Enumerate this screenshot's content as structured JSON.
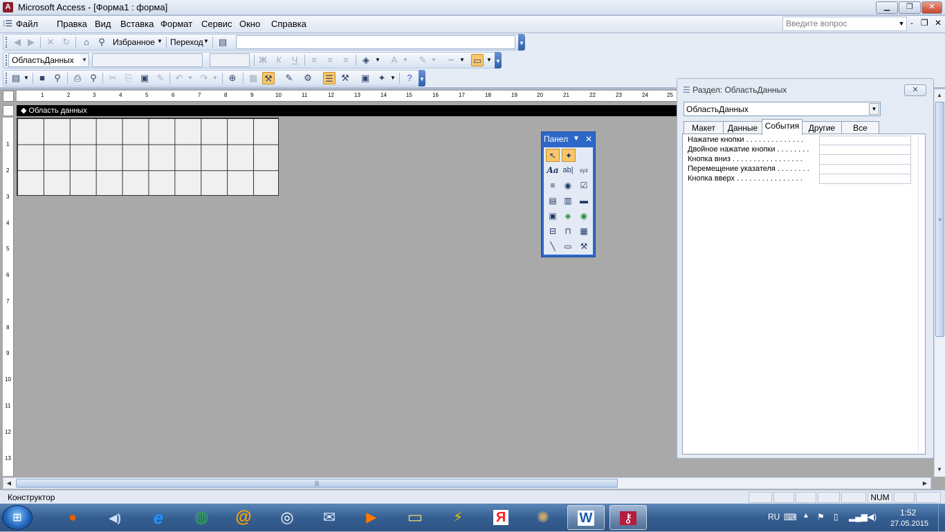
{
  "titlebar": {
    "icon_letter": "A",
    "title": "Microsoft Access - [Форма1 : форма]",
    "minimize": "▁",
    "restore": "❐",
    "close": "✕"
  },
  "menubar": {
    "items": [
      "Файл",
      "Правка",
      "Вид",
      "Вставка",
      "Формат",
      "Сервис",
      "Окно",
      "Справка"
    ],
    "help_placeholder": "Введите вопрос",
    "mdi_buttons": [
      "▾",
      "-",
      "❐",
      "✕"
    ]
  },
  "toolbar_web": {
    "favorites": "Избранное",
    "go": "Переход",
    "address_value": ""
  },
  "toolbar_format": {
    "object_selector": "ОбластьДанных",
    "font_value": "",
    "size_value": "",
    "bold": "Ж",
    "italic": "К",
    "underline": "Ч"
  },
  "ruler": {
    "horizontal_numbers": [
      "1",
      "2",
      "3",
      "4",
      "5",
      "6",
      "7",
      "8",
      "9",
      "10",
      "11",
      "12",
      "13",
      "14",
      "15",
      "16",
      "17",
      "18",
      "19",
      "20",
      "21",
      "22",
      "23",
      "24",
      "25"
    ],
    "vertical_numbers": [
      "1",
      "2",
      "3",
      "4",
      "5",
      "6",
      "7",
      "8",
      "9",
      "10",
      "11",
      "12",
      "13"
    ]
  },
  "form_design": {
    "section_label": "Область данных"
  },
  "toolbox": {
    "title": "Панел",
    "tools": [
      [
        "pointer",
        "wizard"
      ],
      [
        "label",
        "textbox",
        "option-group"
      ],
      [
        "toggle-button",
        "option-button",
        "checkbox"
      ],
      [
        "combo-box",
        "list-box",
        "command-button"
      ],
      [
        "image",
        "unbound-object-frame",
        "bound-object-frame"
      ],
      [
        "page-break",
        "tab-control",
        "subform"
      ],
      [
        "line",
        "rectangle",
        "more-controls"
      ]
    ],
    "tool_glyphs": [
      [
        "↖",
        "✦"
      ],
      [
        "Aa",
        "ab|",
        "xyz"
      ],
      [
        "≡",
        "◉",
        "☑"
      ],
      [
        "▤",
        "▥",
        "▬"
      ],
      [
        "▣",
        "◈",
        "◉"
      ],
      [
        "⊟",
        "⊓",
        "▦"
      ],
      [
        "╲",
        "▭",
        "⚒"
      ]
    ]
  },
  "property_sheet": {
    "title": "Раздел: ОбластьДанных",
    "selector": "ОбластьДанных",
    "tabs": [
      "Макет",
      "Данные",
      "События",
      "Другие",
      "Все"
    ],
    "active_tab": "События",
    "properties": [
      {
        "label": "Нажатие кнопки . . . . . . . . . . . . . .",
        "value": ""
      },
      {
        "label": "Двойное нажатие кнопки . . . . . . . .",
        "value": ""
      },
      {
        "label": "Кнопка вниз . . . . . . . . . . . . . . . . .",
        "value": ""
      },
      {
        "label": "Перемещение указателя . . . . . . . .",
        "value": ""
      },
      {
        "label": "Кнопка вверх . . . . . . . . . . . . . . . .",
        "value": ""
      }
    ]
  },
  "statusbar": {
    "mode": "Конструктор",
    "num": "NUM"
  },
  "taskbar": {
    "apps": [
      {
        "name": "firefox",
        "glyph": "●",
        "color": "#e66000"
      },
      {
        "name": "volume",
        "glyph": "◀)",
        "color": "#cfe2ff"
      },
      {
        "name": "internet-explorer",
        "glyph": "e",
        "color": "#1e90ff"
      },
      {
        "name": "chrome",
        "glyph": "◍",
        "color": "#34a853"
      },
      {
        "name": "mail-ru",
        "glyph": "@",
        "color": "#ffa500"
      },
      {
        "name": "maxthon",
        "glyph": "◎",
        "color": "#ffffff"
      },
      {
        "name": "mail",
        "glyph": "✉",
        "color": "#dce9ff"
      },
      {
        "name": "media-player",
        "glyph": "▶",
        "color": "#ff7a00"
      },
      {
        "name": "explorer",
        "glyph": "▭",
        "color": "#f3d372"
      },
      {
        "name": "winamp",
        "glyph": "⚡",
        "color": "#f5c400"
      },
      {
        "name": "yandex",
        "glyph": "Я",
        "color": "#ff2020"
      },
      {
        "name": "mahjong",
        "glyph": "✺",
        "color": "#c6a96b"
      },
      {
        "name": "word",
        "glyph": "W",
        "color": "#1f5bb5"
      },
      {
        "name": "access",
        "glyph": "⚷",
        "color": "#b41d3d"
      }
    ],
    "language": "RU",
    "time": "1:52",
    "date": "27.05.2015"
  },
  "colors": {
    "accent": "#2d68c8",
    "highlight": "#f8c76b",
    "workspace": "#a9a9a9"
  }
}
